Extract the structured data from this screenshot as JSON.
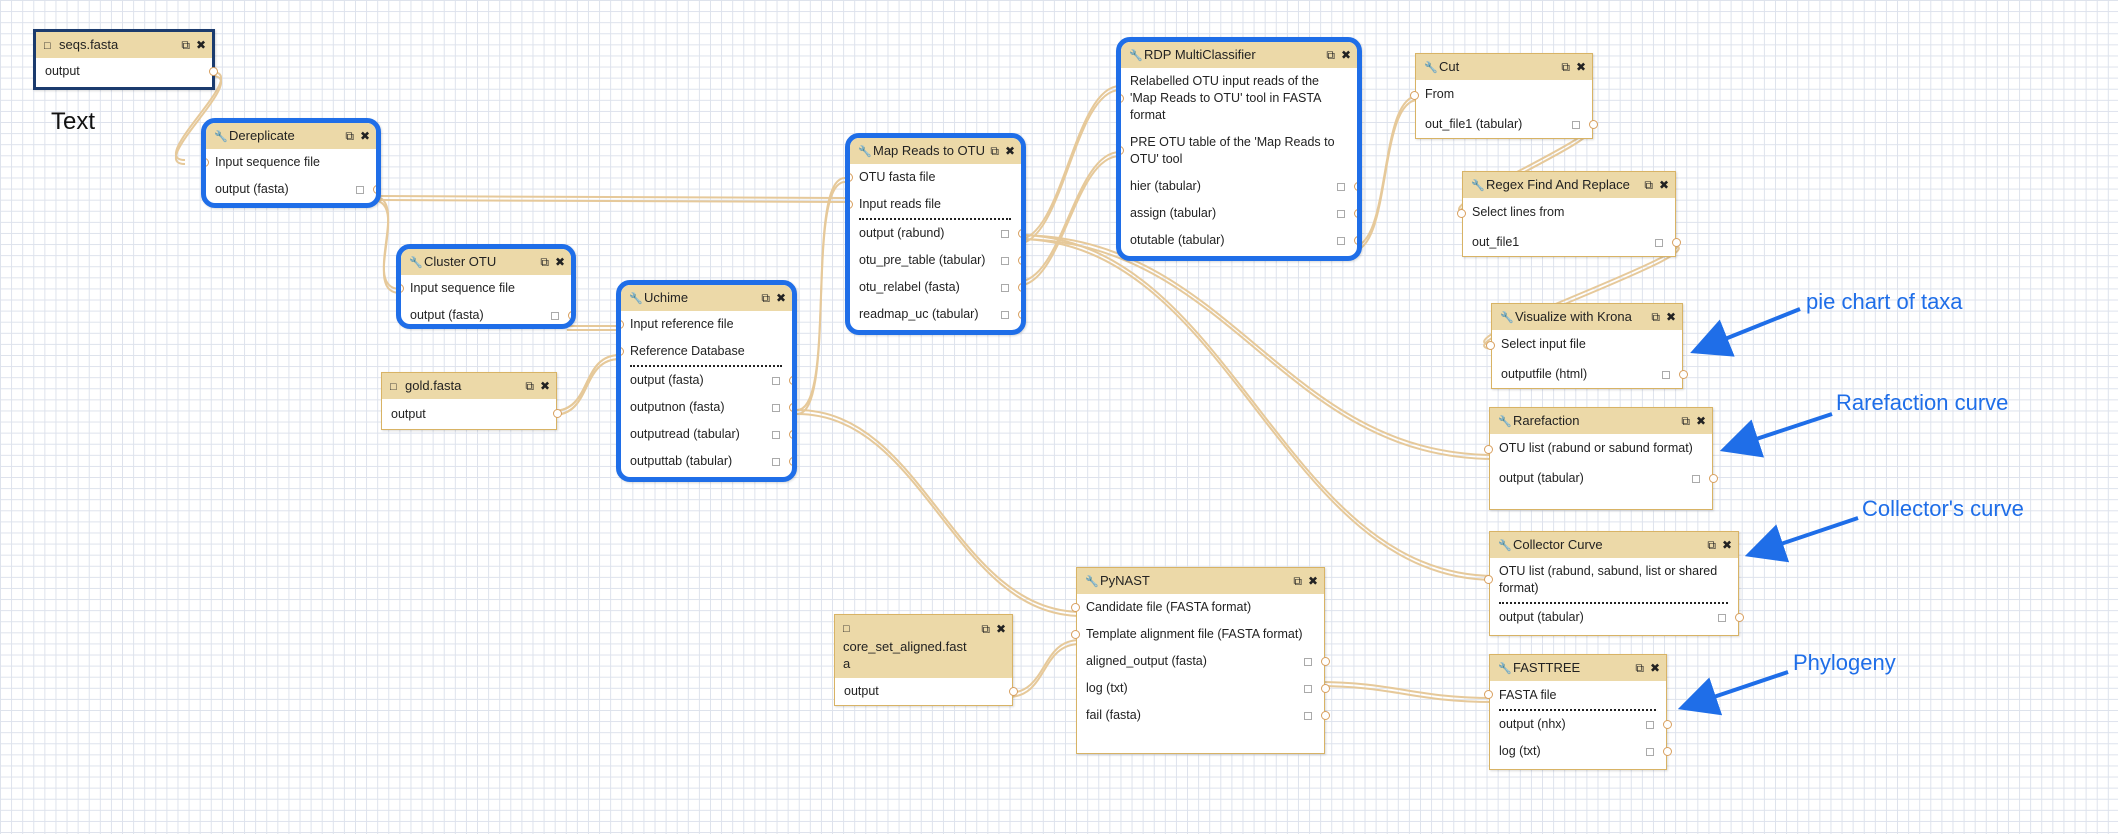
{
  "canvas_text": "Text",
  "icons": {
    "tool": "wrench-icon",
    "input": "file-icon",
    "copy": "copy-icon",
    "close": "close-icon"
  },
  "colors": {
    "node_border": "#d8b365",
    "header": "#ecd9a8",
    "selection": "#1f6ee8",
    "wire": "#e3c69a",
    "annotation": "#1f6ee8"
  },
  "nodes": {
    "seqs": {
      "title": "seqs.fasta",
      "rows": [
        "output"
      ]
    },
    "dereplicate": {
      "title": "Dereplicate",
      "rows": [
        "Input sequence file",
        "output (fasta)"
      ]
    },
    "cluster": {
      "title": "Cluster OTU",
      "rows": [
        "Input sequence file",
        "output (fasta)"
      ]
    },
    "gold": {
      "title": "gold.fasta",
      "rows": [
        "output"
      ]
    },
    "uchime": {
      "title": "Uchime",
      "rows": [
        "Input reference file",
        "Reference Database",
        "output (fasta)",
        "outputnon (fasta)",
        "outputread (tabular)",
        "outputtab (tabular)"
      ]
    },
    "mapreads": {
      "title": "Map Reads to OTU",
      "rows": [
        "OTU fasta file",
        "Input reads file",
        "output (rabund)",
        "otu_pre_table (tabular)",
        "otu_relabel (fasta)",
        "readmap_uc (tabular)"
      ]
    },
    "rdp": {
      "title": "RDP MultiClassifier",
      "rows": [
        "Relabelled OTU input reads of the 'Map Reads to OTU' tool in FASTA format",
        "PRE OTU table of the 'Map Reads to OTU' tool",
        "hier (tabular)",
        "assign (tabular)",
        "otutable (tabular)"
      ]
    },
    "cut": {
      "title": "Cut",
      "rows": [
        "From",
        "out_file1 (tabular)"
      ]
    },
    "regex": {
      "title": "Regex Find And Replace",
      "rows": [
        "Select lines from",
        "out_file1"
      ]
    },
    "krona": {
      "title": "Visualize with Krona",
      "rows": [
        "Select input file",
        "outputfile (html)"
      ]
    },
    "rarefaction": {
      "title": "Rarefaction",
      "rows": [
        "OTU list (rabund or sabund format)",
        "output (tabular)"
      ]
    },
    "collector": {
      "title": "Collector Curve",
      "rows": [
        "OTU list (rabund, sabund, list or shared format)",
        "output (tabular)"
      ]
    },
    "pynast": {
      "title": "PyNAST",
      "rows": [
        "Candidate file (FASTA format)",
        "Template alignment file (FASTA format)",
        "aligned_output (fasta)",
        "log (txt)",
        "fail (fasta)"
      ]
    },
    "coreset": {
      "title": "core_set_aligned.fasta",
      "rows": [
        "output"
      ]
    },
    "fasttree": {
      "title": "FASTTREE",
      "rows": [
        "FASTA file",
        "output (nhx)",
        "log (txt)"
      ]
    }
  },
  "annotations": [
    "pie chart of taxa",
    "Rarefaction curve",
    "Collector's curve",
    "Phylogeny"
  ]
}
